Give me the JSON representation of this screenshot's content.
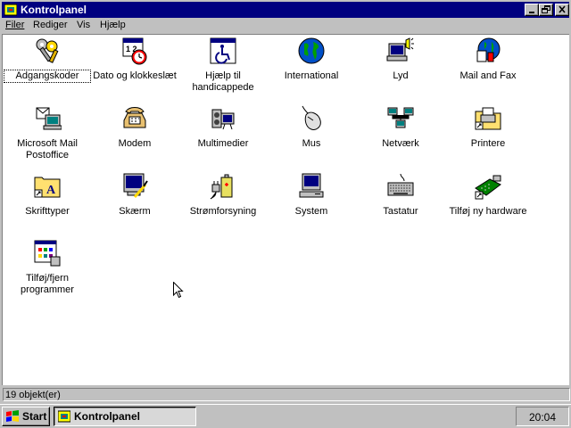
{
  "window": {
    "title": "Kontrolpanel"
  },
  "menu": [
    {
      "label": "Filer"
    },
    {
      "label": "Rediger"
    },
    {
      "label": "Vis"
    },
    {
      "label": "Hjælp"
    }
  ],
  "items": [
    {
      "label": "Adgangskoder",
      "icon": "keys-icon"
    },
    {
      "label": "Dato og klokkeslæt",
      "icon": "calendar-clock-icon"
    },
    {
      "label": "Hjælp til handicappede",
      "icon": "accessibility-icon"
    },
    {
      "label": "International",
      "icon": "globe-icon"
    },
    {
      "label": "Lyd",
      "icon": "speaker-icon"
    },
    {
      "label": "Mail and Fax",
      "icon": "mail-fax-icon"
    },
    {
      "label": "Microsoft Mail Postoffice",
      "icon": "postoffice-icon"
    },
    {
      "label": "Modem",
      "icon": "telephone-icon"
    },
    {
      "label": "Multimedier",
      "icon": "multimedia-icon"
    },
    {
      "label": "Mus",
      "icon": "mouse-icon"
    },
    {
      "label": "Netværk",
      "icon": "network-icon"
    },
    {
      "label": "Printere",
      "icon": "printer-folder-icon"
    },
    {
      "label": "Skrifttyper",
      "icon": "fonts-folder-icon"
    },
    {
      "label": "Skærm",
      "icon": "display-icon"
    },
    {
      "label": "Strømforsyning",
      "icon": "battery-plug-icon"
    },
    {
      "label": "System",
      "icon": "computer-icon"
    },
    {
      "label": "Tastatur",
      "icon": "keyboard-icon"
    },
    {
      "label": "Tilføj ny hardware",
      "icon": "add-hardware-icon"
    },
    {
      "label": "Tilføj/fjern programmer",
      "icon": "add-remove-programs-icon"
    }
  ],
  "status": {
    "text": "19 objekt(er)"
  },
  "taskbar": {
    "start_label": "Start",
    "task_label": "Kontrolpanel",
    "clock": "20:04"
  },
  "colors": {
    "titlebar": "#000080",
    "face": "#c0c0c0",
    "desktop": "#008080"
  }
}
